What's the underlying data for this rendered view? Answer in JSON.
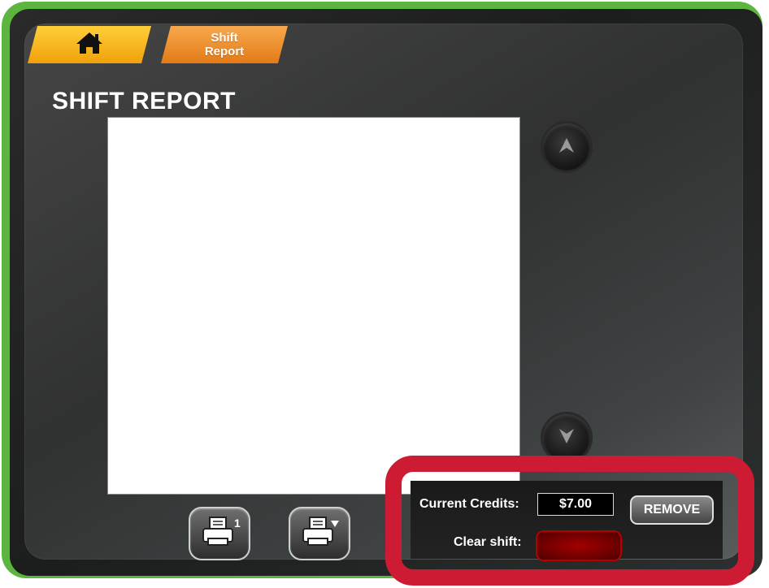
{
  "tabs": {
    "home_icon": "home-icon",
    "shift_report_line1": "Shift",
    "shift_report_line2": "Report"
  },
  "page": {
    "title": "SHIFT REPORT"
  },
  "controls": {
    "scroll_up_icon": "arrow-up-icon",
    "scroll_down_icon": "arrow-down-icon",
    "print_one_icon": "printer-1-icon",
    "print_select_icon": "printer-dropdown-icon"
  },
  "credits": {
    "current_label": "Current Credits:",
    "current_value": "$7.00",
    "remove_label": "REMOVE",
    "clear_label": "Clear shift:"
  },
  "colors": {
    "accent_green": "#5cb53f",
    "tab_yellow": "#f5b21a",
    "tab_orange": "#ea8a20",
    "highlight_red": "#cc1b33"
  }
}
